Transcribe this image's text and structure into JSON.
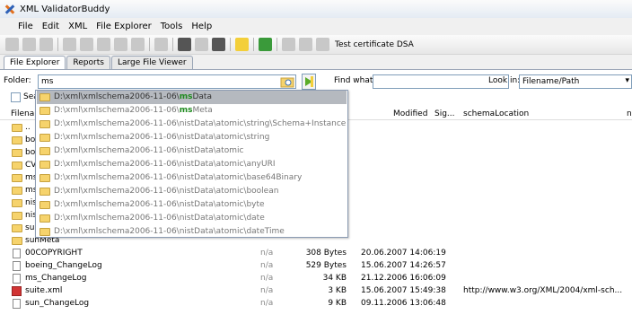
{
  "window": {
    "title": "XML ValidatorBuddy"
  },
  "menu": [
    "File",
    "Edit",
    "XML",
    "File Explorer",
    "Tools",
    "Help"
  ],
  "toolbar": {
    "cert_label": "Test certificate DSA"
  },
  "tabs": [
    "File Explorer",
    "Reports",
    "Large File Viewer"
  ],
  "folder": {
    "label": "Folder:",
    "value": "ms"
  },
  "find": {
    "label": "Find what:",
    "value": ""
  },
  "lookin": {
    "label": "Look in:",
    "value": "Filename/Path"
  },
  "search_row": {
    "label": "Sear"
  },
  "columns": {
    "filename": "Filenam",
    "modified": "Modified",
    "sig": "Sig...",
    "schema": "schemaLocation",
    "extra": "n"
  },
  "autocomplete": [
    {
      "prefix": "D:\\xml\\xmlschema2006-11-06\\",
      "match": "ms",
      "suffix": "Data"
    },
    {
      "prefix": "D:\\xml\\xmlschema2006-11-06\\",
      "match": "ms",
      "suffix": "Meta"
    },
    {
      "prefix": "D:\\xml\\xmlschema2006-11-06\\nistData\\atomic\\string\\Schema+Instance",
      "match": "",
      "suffix": ""
    },
    {
      "prefix": "D:\\xml\\xmlschema2006-11-06\\nistData\\atomic\\string",
      "match": "",
      "suffix": ""
    },
    {
      "prefix": "D:\\xml\\xmlschema2006-11-06\\nistData\\atomic",
      "match": "",
      "suffix": ""
    },
    {
      "prefix": "D:\\xml\\xmlschema2006-11-06\\nistData\\atomic\\anyURI",
      "match": "",
      "suffix": ""
    },
    {
      "prefix": "D:\\xml\\xmlschema2006-11-06\\nistData\\atomic\\base64Binary",
      "match": "",
      "suffix": ""
    },
    {
      "prefix": "D:\\xml\\xmlschema2006-11-06\\nistData\\atomic\\boolean",
      "match": "",
      "suffix": ""
    },
    {
      "prefix": "D:\\xml\\xmlschema2006-11-06\\nistData\\atomic\\byte",
      "match": "",
      "suffix": ""
    },
    {
      "prefix": "D:\\xml\\xmlschema2006-11-06\\nistData\\atomic\\date",
      "match": "",
      "suffix": ""
    },
    {
      "prefix": "D:\\xml\\xmlschema2006-11-06\\nistData\\atomic\\dateTime",
      "match": "",
      "suffix": ""
    }
  ],
  "rows": [
    {
      "type": "folder",
      "name": "..",
      "na": "",
      "size": "",
      "modified": "",
      "schema": ""
    },
    {
      "type": "folder",
      "name": "boe",
      "na": "",
      "size": "",
      "modified": "",
      "schema": ""
    },
    {
      "type": "folder",
      "name": "boe",
      "na": "",
      "size": "",
      "modified": "",
      "schema": ""
    },
    {
      "type": "folder",
      "name": "CVS",
      "na": "",
      "size": "",
      "modified": "",
      "schema": ""
    },
    {
      "type": "folder",
      "name": "ms",
      "na": "",
      "size": "",
      "modified": "",
      "schema": ""
    },
    {
      "type": "folder",
      "name": "ms",
      "na": "",
      "size": "",
      "modified": "",
      "schema": ""
    },
    {
      "type": "folder",
      "name": "nist",
      "na": "",
      "size": "",
      "modified": "",
      "schema": ""
    },
    {
      "type": "folder",
      "name": "nist",
      "na": "",
      "size": "",
      "modified": "",
      "schema": ""
    },
    {
      "type": "folder",
      "name": "sunData",
      "na": "",
      "size": "",
      "modified": "",
      "schema": ""
    },
    {
      "type": "folder",
      "name": "sunMeta",
      "na": "",
      "size": "",
      "modified": "",
      "schema": ""
    },
    {
      "type": "doc",
      "name": "00COPYRIGHT",
      "na": "n/a",
      "size": "308 Bytes",
      "modified": "20.06.2007 14:06:19",
      "schema": ""
    },
    {
      "type": "doc",
      "name": "boeing_ChangeLog",
      "na": "n/a",
      "size": "529 Bytes",
      "modified": "15.06.2007 14:26:57",
      "schema": ""
    },
    {
      "type": "doc",
      "name": "ms_ChangeLog",
      "na": "n/a",
      "size": "34 KB",
      "modified": "21.12.2006 16:06:09",
      "schema": ""
    },
    {
      "type": "xml",
      "name": "suite.xml",
      "na": "n/a",
      "size": "3 KB",
      "modified": "15.06.2007 15:49:38",
      "schema": "http://www.w3.org/XML/2004/xml-sch..."
    },
    {
      "type": "doc",
      "name": "sun_ChangeLog",
      "na": "n/a",
      "size": "9 KB",
      "modified": "09.11.2006 13:06:48",
      "schema": ""
    }
  ]
}
